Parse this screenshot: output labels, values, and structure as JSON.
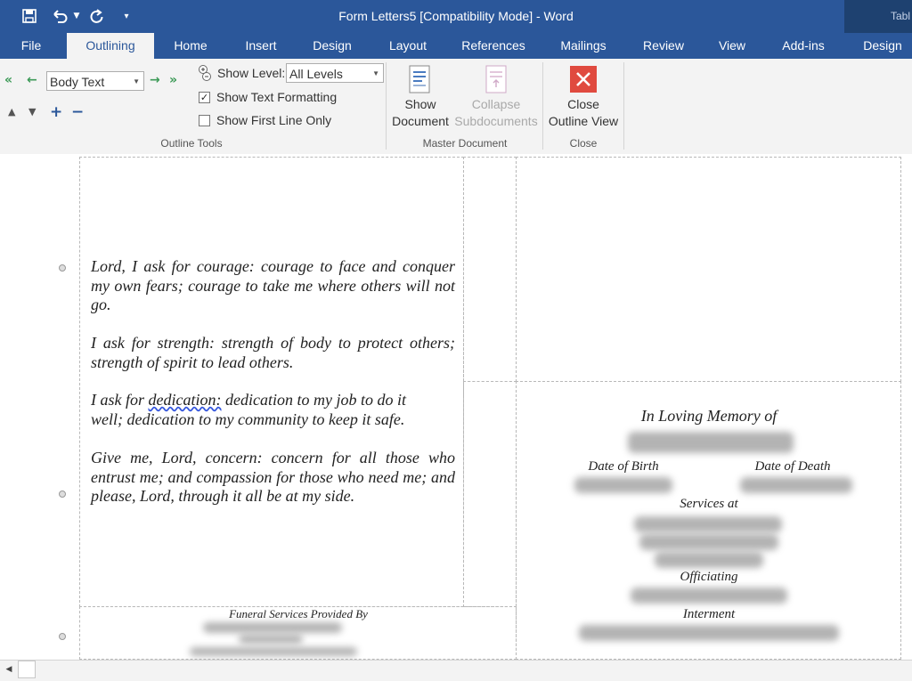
{
  "window": {
    "title": "Form Letters5 [Compatibility Mode] - Word",
    "context_tab_group": "Tabl"
  },
  "quick_access": {
    "save_icon": "save-icon",
    "undo_icon": "undo-icon",
    "redo_icon": "redo-icon",
    "customize_icon": "customize-qat-icon"
  },
  "tabs": [
    "File",
    "Outlining",
    "Home",
    "Insert",
    "Design",
    "Layout",
    "References",
    "Mailings",
    "Review",
    "View",
    "Add-ins",
    "Design"
  ],
  "active_tab": "Outlining",
  "ribbon": {
    "outline_tools": {
      "level_value": "Body Text",
      "show_level_label": "Show Level:",
      "show_level_value": "All Levels",
      "show_text_formatting_label": "Show Text Formatting",
      "show_text_formatting_checked": true,
      "show_first_line_only_label": "Show First Line Only",
      "show_first_line_only_checked": false,
      "group_label": "Outline Tools"
    },
    "master_document": {
      "show_document_line1": "Show",
      "show_document_line2": "Document",
      "collapse_line1": "Collapse",
      "collapse_line2": "Subdocuments",
      "group_label": "Master Document"
    },
    "close": {
      "close_line1": "Close",
      "close_line2": "Outline View",
      "group_label": "Close"
    }
  },
  "document": {
    "prayer": [
      "Lord, I ask for courage: courage to face and conquer my own fears; courage to take me where others will not go.",
      "I ask for strength: strength of body to protect others; strength of spirit to lead others.",
      "well; dedication to my community to keep it safe.",
      "Give me, Lord, concern: concern for all those who entrust me; and compassion for those who need me; and please, Lord, through it all be at my side."
    ],
    "dedication_line": {
      "prefix": "I ask for ",
      "misspelled": "dedication:",
      "suffix": " dedication to my job to do it"
    },
    "funeral_services": "Funeral Services Provided By",
    "memorial": {
      "title": "In Loving Memory of",
      "date_of_birth": "Date of Birth",
      "date_of_death": "Date of Death",
      "services_at": "Services at",
      "officiating": "Officiating",
      "interment": "Interment"
    }
  },
  "colors": {
    "ribbon_blue": "#2b579a",
    "ribbon_bg": "#f3f3f3",
    "outline_arrow": "#3c9a57",
    "close_red": "#e04a3f"
  }
}
